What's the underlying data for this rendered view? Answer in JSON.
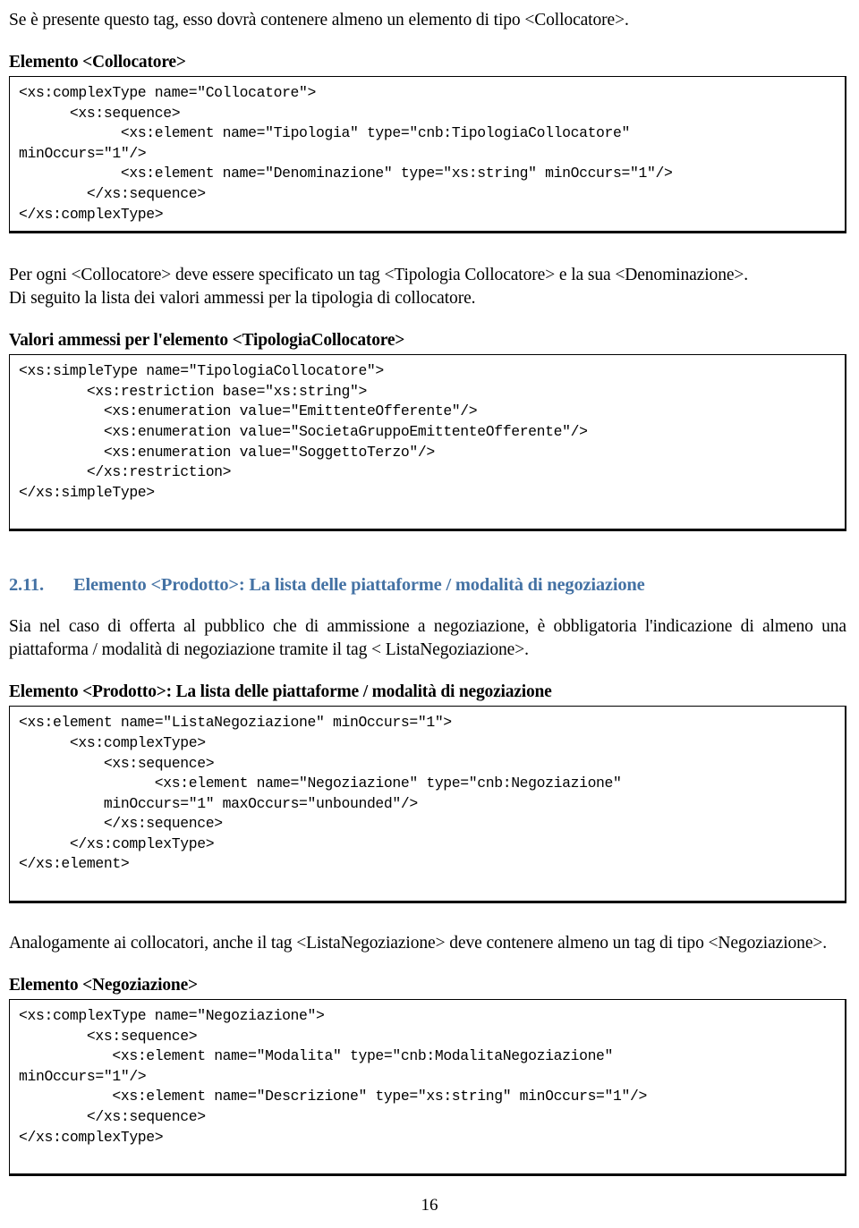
{
  "document": {
    "page_number": "16",
    "heading_color": "#4472a4",
    "intro_paragraph": "Se è presente questo tag, esso dovrà contenere almeno un elemento di tipo <Collocatore>.",
    "sections": [
      {
        "id": "collocatore",
        "heading": "Elemento <Collocatore>",
        "code": "<xs:complexType name=\"Collocatore\">\n      <xs:sequence>\n            <xs:element name=\"Tipologia\" type=\"cnb:TipologiaCollocatore\"\nminOccurs=\"1\"/>\n            <xs:element name=\"Denominazione\" type=\"xs:string\" minOccurs=\"1\"/>\n        </xs:sequence>\n</xs:complexType>"
      },
      {
        "id": "tipologia-collocatore",
        "heading": "Valori ammessi per l'elemento <TipologiaCollocatore>",
        "code": "<xs:simpleType name=\"TipologiaCollocatore\">\n        <xs:restriction base=\"xs:string\">\n          <xs:enumeration value=\"EmittenteOfferente\"/>\n          <xs:enumeration value=\"SocietaGruppoEmittenteOfferente\"/>\n          <xs:enumeration value=\"SoggettoTerzo\"/>\n        </xs:restriction>\n</xs:simpleType>"
      },
      {
        "id": "prodotto-lista-negoziazione",
        "heading": "Elemento <Prodotto>: La lista delle piattaforme / modalità di negoziazione",
        "code": "<xs:element name=\"ListaNegoziazione\" minOccurs=\"1\">\n      <xs:complexType>\n          <xs:sequence>\n                <xs:element name=\"Negoziazione\" type=\"cnb:Negoziazione\"\n          minOccurs=\"1\" maxOccurs=\"unbounded\"/>\n          </xs:sequence>\n      </xs:complexType>\n</xs:element>"
      },
      {
        "id": "negoziazione",
        "heading": "Elemento <Negoziazione>",
        "code": "<xs:complexType name=\"Negoziazione\">\n        <xs:sequence>\n           <xs:element name=\"Modalita\" type=\"cnb:ModalitaNegoziazione\"\nminOccurs=\"1\"/>\n           <xs:element name=\"Descrizione\" type=\"xs:string\" minOccurs=\"1\"/>\n        </xs:sequence>\n</xs:complexType>"
      }
    ],
    "paragraphs": {
      "after_collocatore_line1": "Per ogni <Collocatore> deve essere specificato un tag <Tipologia Collocatore> e la sua <Denominazione>.",
      "after_collocatore_line2": "Di seguito la lista dei valori ammessi per la tipologia di collocatore.",
      "section_2_11_number": "2.11.",
      "section_2_11_title": "Elemento <Prodotto>: La lista delle piattaforme / modalità di negoziazione",
      "after_2_11": "Sia nel caso di offerta al pubblico che di ammissione a negoziazione, è obbligatoria l'indicazione di almeno una piattaforma / modalità di negoziazione tramite il tag < ListaNegoziazione>.",
      "after_lista_negoziazione": "Analogamente ai collocatori, anche il tag <ListaNegoziazione> deve contenere almeno un tag di tipo <Negoziazione>."
    }
  }
}
